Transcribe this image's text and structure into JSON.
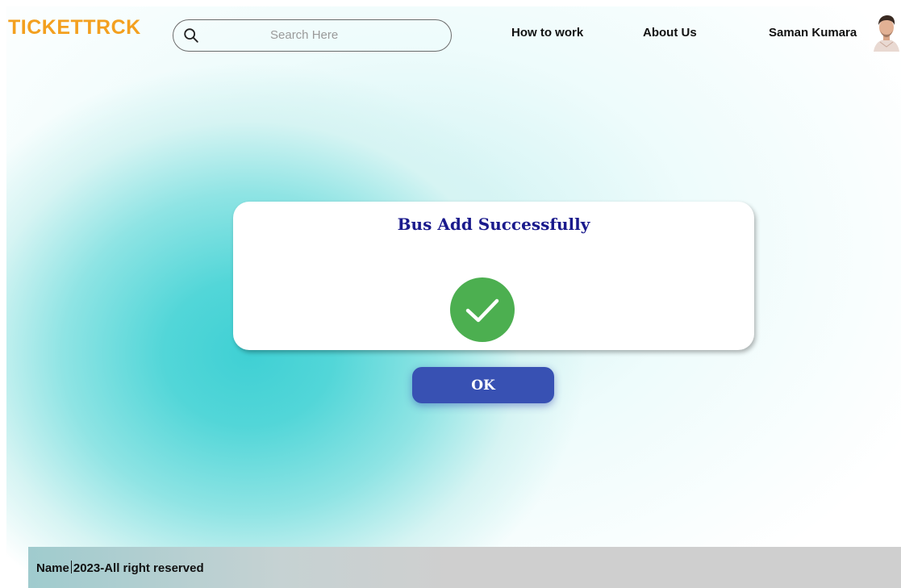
{
  "header": {
    "brand": "TICKETTRCK",
    "search": {
      "placeholder": "Search Here",
      "value": ""
    },
    "nav": [
      {
        "label": "How to work"
      },
      {
        "label": "About Us"
      }
    ],
    "user": {
      "name": "Saman Kumara"
    }
  },
  "dialog": {
    "title": "Bus Add Successfully",
    "icon": "check-circle",
    "ok_label": "OK"
  },
  "footer": {
    "name": "Name",
    "text": "2023-All right reserved"
  },
  "colors": {
    "brand": "#f3a01f",
    "dialog_title": "#1a1a8c",
    "success": "#4caf50",
    "ok_button": "#3851b3",
    "background_accent": "#3fd0d4",
    "footer": "#cfcfcf"
  }
}
